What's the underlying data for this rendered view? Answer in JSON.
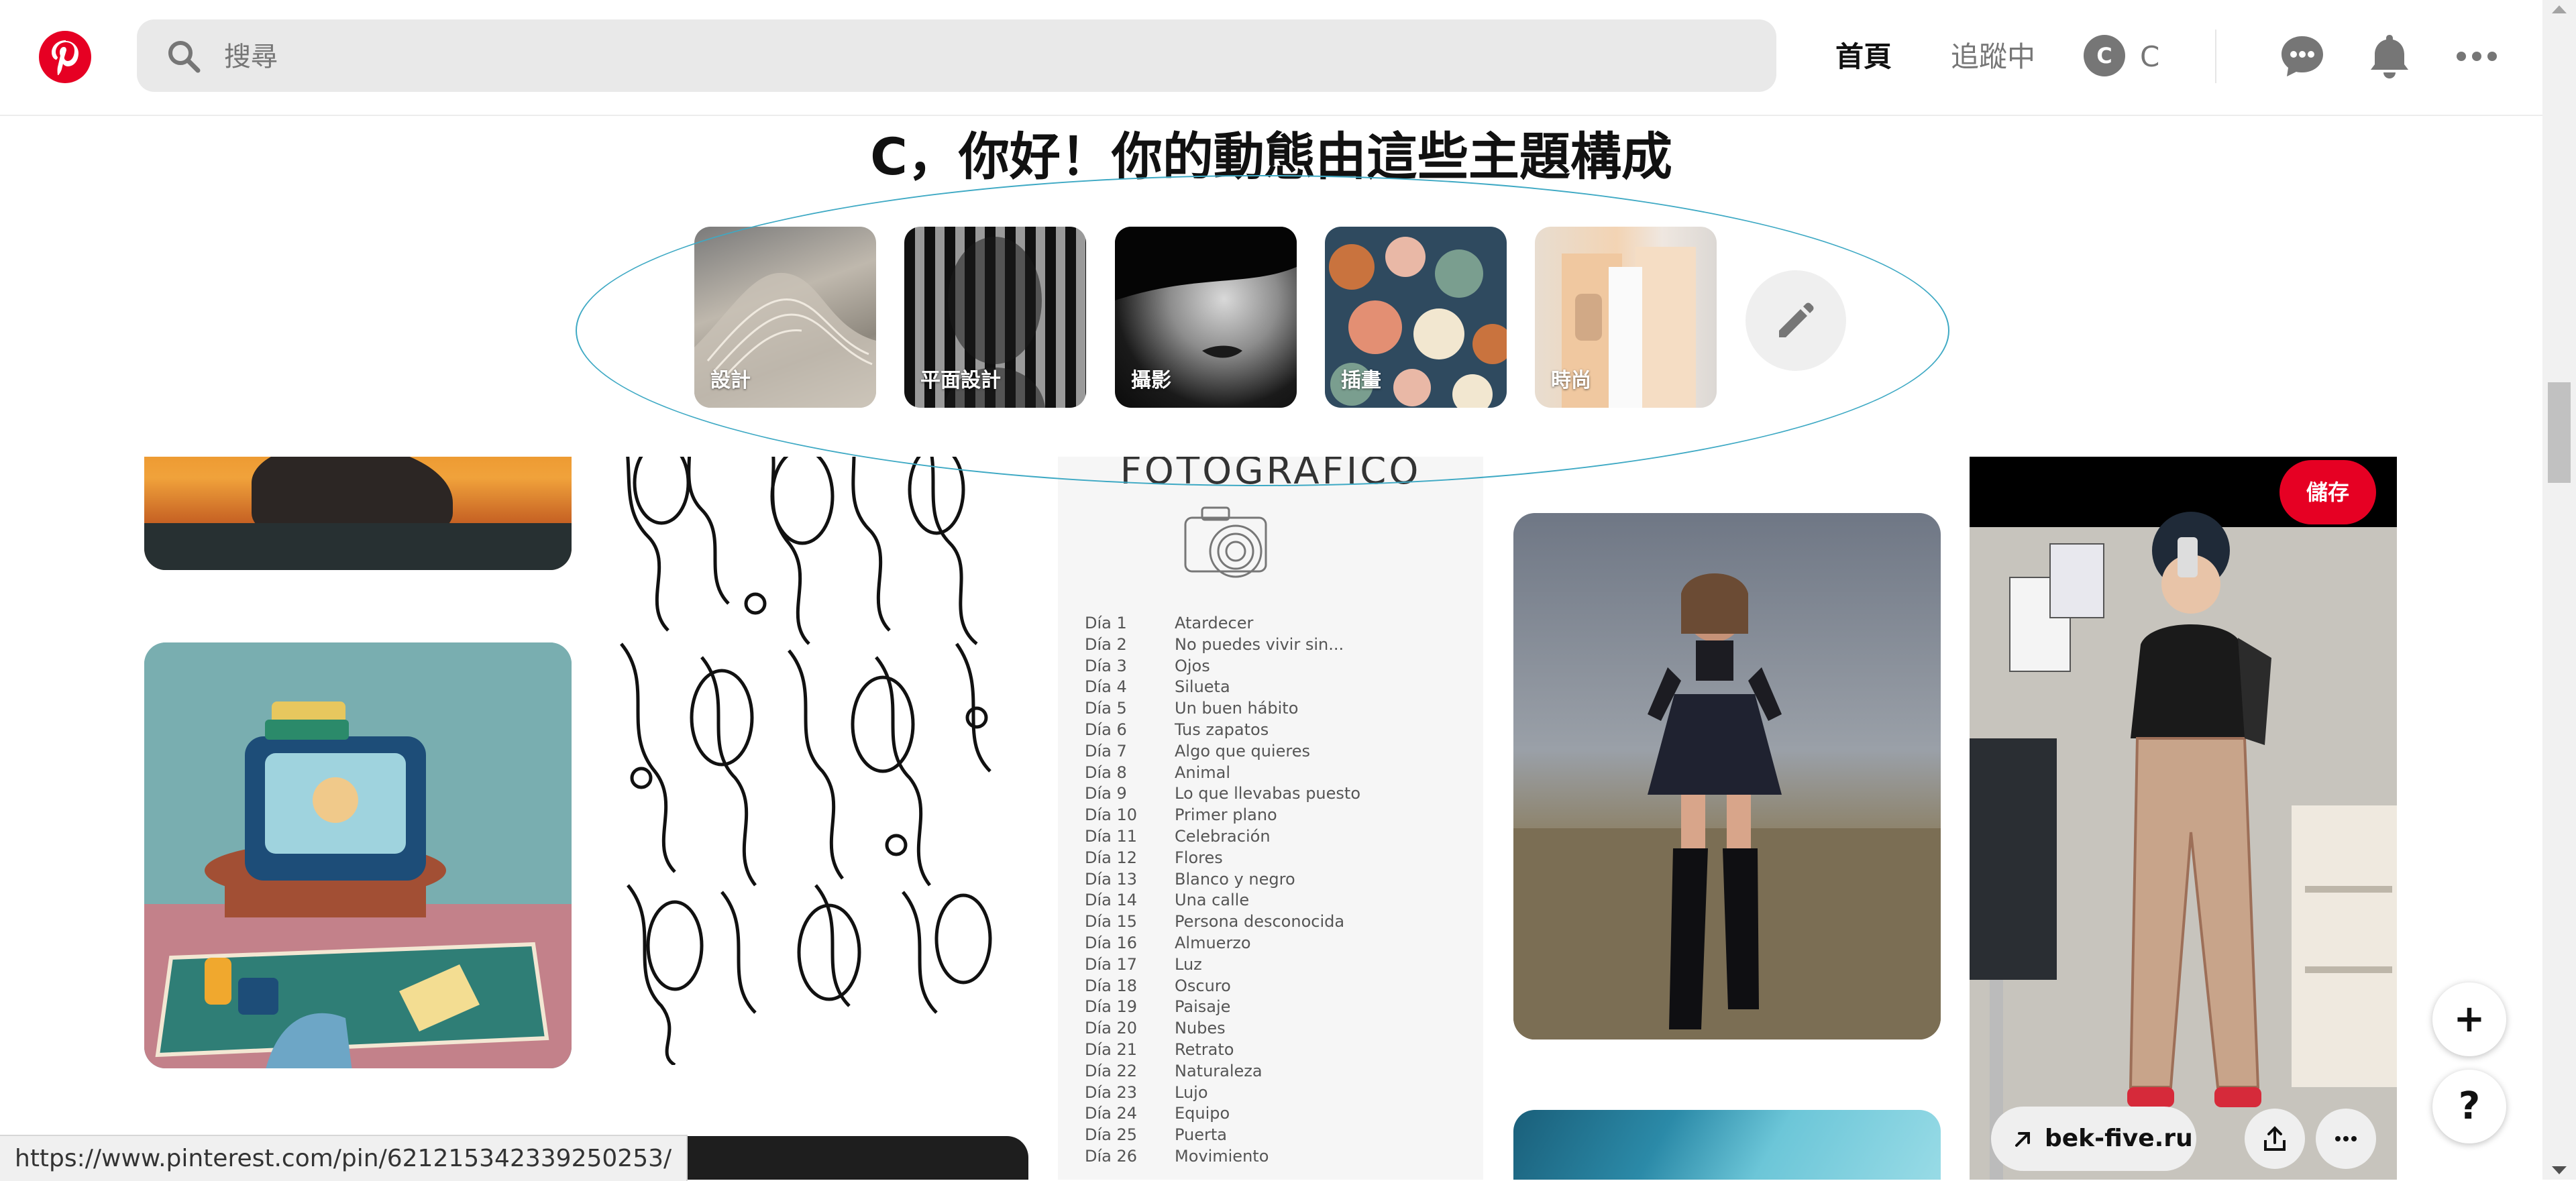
{
  "header": {
    "search_placeholder": "搜尋",
    "nav_home": "首頁",
    "nav_following": "追蹤中",
    "avatar_initial": "C",
    "username": "C",
    "icons": [
      "pinterest-logo",
      "search-icon",
      "messages-icon",
      "notifications-icon",
      "more-icon"
    ],
    "brand_color": "#e60023"
  },
  "topics": {
    "title": "C，你好！你的動態由這些主題構成",
    "cards": [
      {
        "label": "設計"
      },
      {
        "label": "平面設計"
      },
      {
        "label": "攝影"
      },
      {
        "label": "插畫"
      },
      {
        "label": "時尚"
      }
    ],
    "edit_icon": "pencil-icon"
  },
  "pins": {
    "text_pin": {
      "heading": "FOTOGRAFICO",
      "days": [
        [
          "Día 1",
          "Atardecer"
        ],
        [
          "Día 2",
          "No puedes vivir sin..."
        ],
        [
          "Día 3",
          "Ojos"
        ],
        [
          "Día 4",
          "Silueta"
        ],
        [
          "Día 5",
          "Un buen hábito"
        ],
        [
          "Día 6",
          "Tus zapatos"
        ],
        [
          "Día 7",
          "Algo que quieres"
        ],
        [
          "Día 8",
          "Animal"
        ],
        [
          "Día 9",
          "Lo que llevabas puesto"
        ],
        [
          "Día 10",
          "Primer plano"
        ],
        [
          "Día 11",
          "Celebración"
        ],
        [
          "Día 12",
          "Flores"
        ],
        [
          "Día 13",
          "Blanco y negro"
        ],
        [
          "Día 14",
          "Una calle"
        ],
        [
          "Día 15",
          "Persona desconocida"
        ],
        [
          "Día 16",
          "Almuerzo"
        ],
        [
          "Día 17",
          "Luz"
        ],
        [
          "Día 18",
          "Oscuro"
        ],
        [
          "Día 19",
          "Paisaje"
        ],
        [
          "Día 20",
          "Nubes"
        ],
        [
          "Día 21",
          "Retrato"
        ],
        [
          "Día 22",
          "Naturaleza"
        ],
        [
          "Día 23",
          "Lujo"
        ],
        [
          "Día 24",
          "Equipo"
        ],
        [
          "Día 25",
          "Puerta"
        ],
        [
          "Día 26",
          "Movimiento"
        ]
      ]
    },
    "fashion_pin": {
      "save_label": "儲存",
      "link_label": "bek-five.ru"
    }
  },
  "floating": {
    "add_label": "+",
    "help_label": "?"
  },
  "status_url": "https://www.pinterest.com/pin/621215342339250253/"
}
